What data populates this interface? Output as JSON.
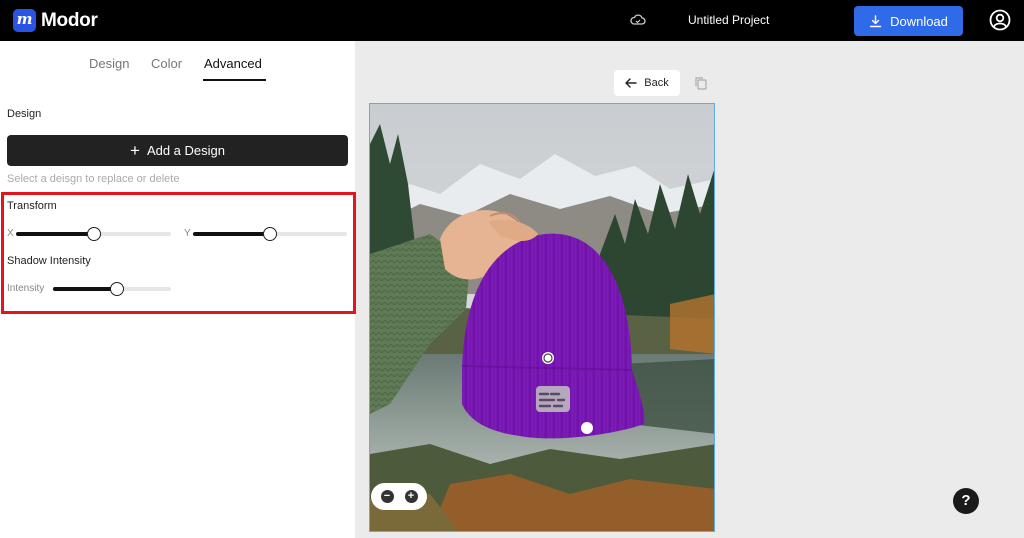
{
  "app": {
    "name": "Modor",
    "logo_glyph": "m",
    "project_title": "Untitled Project"
  },
  "header": {
    "download_label": "Download"
  },
  "tabs": [
    {
      "label": "Design",
      "active": false
    },
    {
      "label": "Color",
      "active": false
    },
    {
      "label": "Advanced",
      "active": true
    }
  ],
  "design_section": {
    "heading": "Design",
    "add_button_label": "Add a Design",
    "hint": "Select a deisgn to replace or delete"
  },
  "transform": {
    "heading": "Transform",
    "x_label": "X",
    "y_label": "Y",
    "x_value_fraction": 0.5,
    "y_value_fraction": 0.5
  },
  "shadow": {
    "heading": "Shadow Intensity",
    "intensity_label": "Intensity",
    "intensity_fraction": 0.54
  },
  "canvas": {
    "back_label": "Back",
    "product_color": "#8a1fc7",
    "zoom_out_glyph": "−",
    "zoom_in_glyph": "+"
  },
  "help": {
    "glyph": "?"
  },
  "colors": {
    "accent": "#2f6ae8",
    "highlight": "#e2141c",
    "selection": "#5aaef0"
  }
}
